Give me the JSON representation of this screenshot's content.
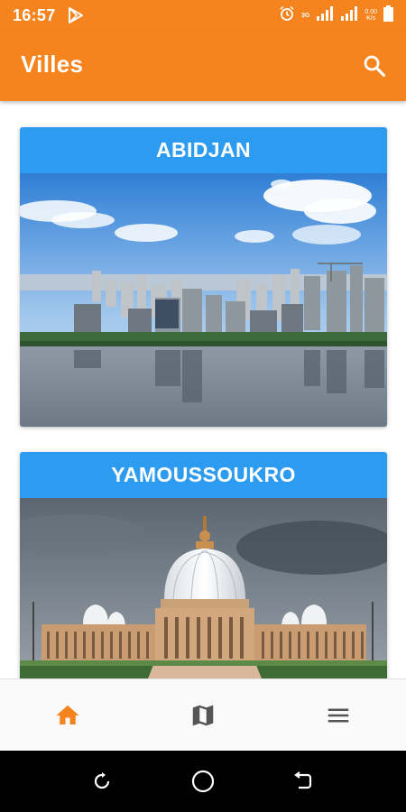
{
  "status_bar": {
    "time": "16:57",
    "network_type": "3G",
    "speed_value": "0.00",
    "speed_unit": "K/s",
    "icons": [
      "play-store-icon",
      "alarm-icon",
      "signal-icon",
      "signal-icon",
      "battery-icon"
    ]
  },
  "app_bar": {
    "title": "Villes",
    "search_icon": "search-icon"
  },
  "cities": [
    {
      "name": "ABIDJAN"
    },
    {
      "name": "YAMOUSSOUKRO"
    }
  ],
  "bottom_nav": {
    "items": [
      {
        "icon": "home-icon",
        "active": true
      },
      {
        "icon": "map-icon",
        "active": false
      },
      {
        "icon": "menu-icon",
        "active": false
      }
    ]
  },
  "system_nav": {
    "buttons": [
      "recents-icon",
      "home-circle-icon",
      "back-icon"
    ]
  },
  "colors": {
    "primary": "#f5841f",
    "card_header": "#2d9cf0",
    "nav_active": "#f5841f",
    "nav_inactive": "#555555"
  }
}
